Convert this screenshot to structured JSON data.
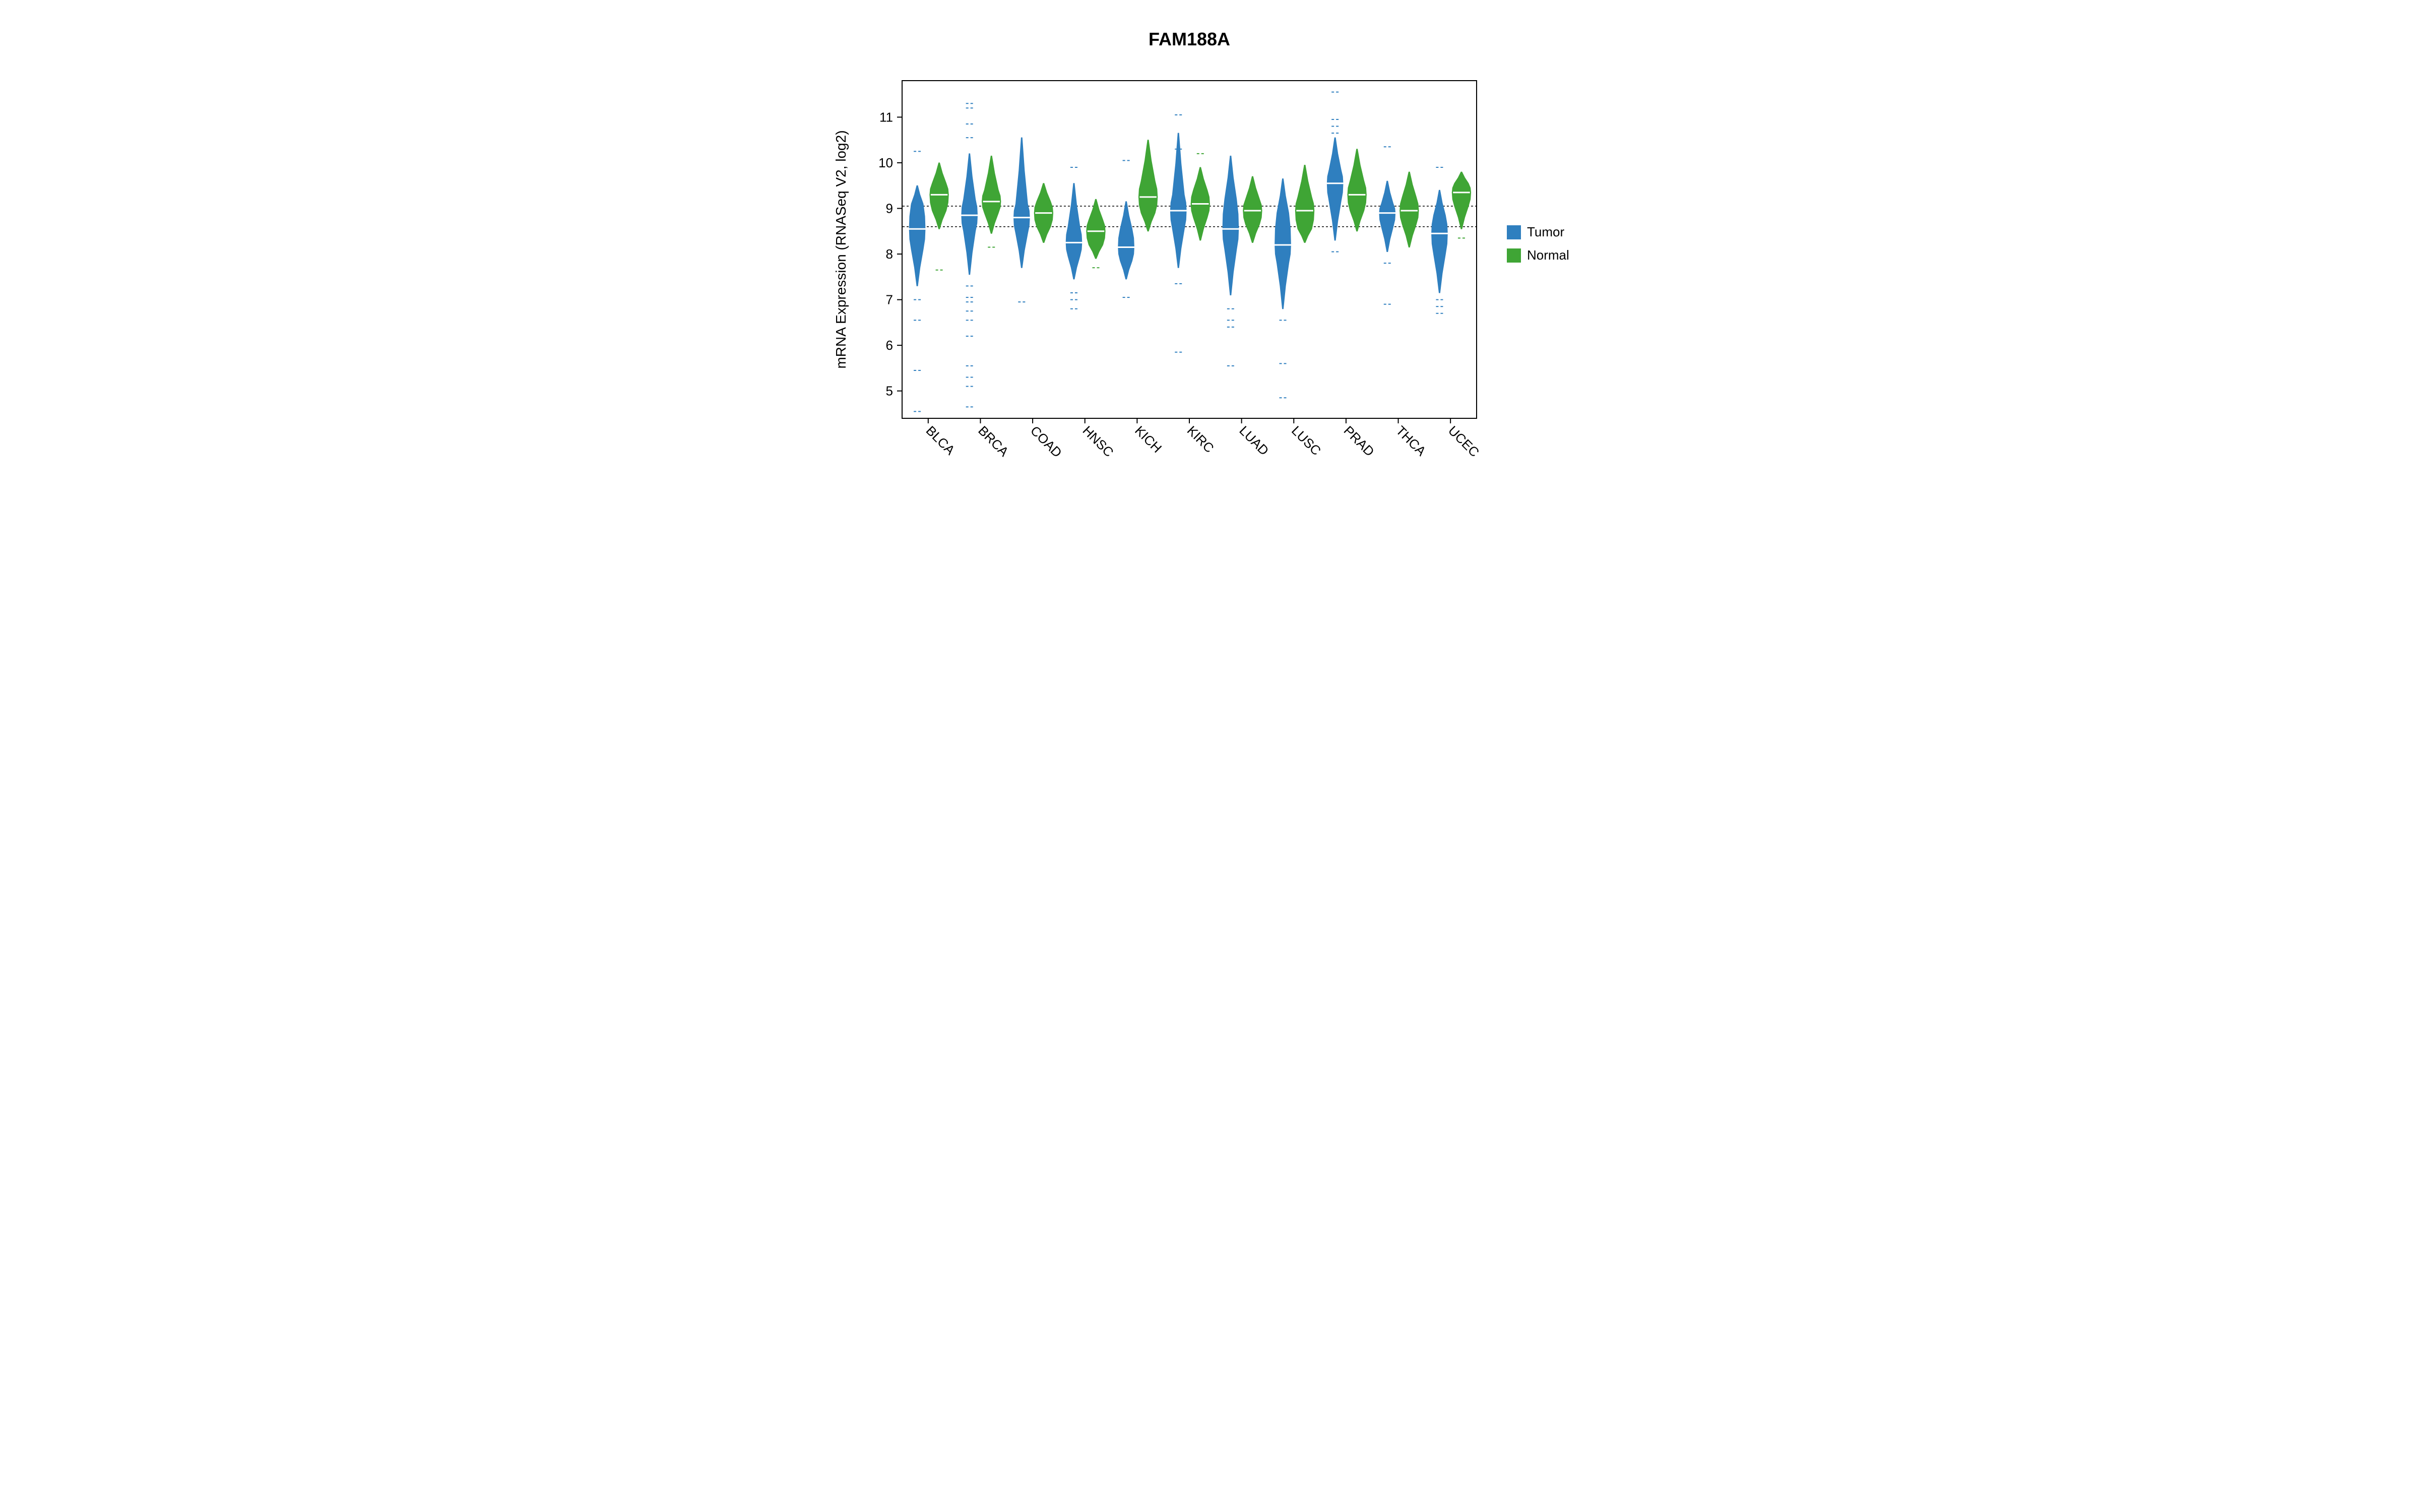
{
  "chart_data": {
    "type": "bar",
    "title": "FAM188A",
    "ylabel": "mRNA Expression (RNASeq V2, log2)",
    "xlabel": "",
    "ylim": [
      4.4,
      11.8
    ],
    "yticks": [
      5,
      6,
      7,
      8,
      9,
      10,
      11
    ],
    "categories": [
      "BLCA",
      "BRCA",
      "COAD",
      "HNSC",
      "KICH",
      "KIRC",
      "LUAD",
      "LUSC",
      "PRAD",
      "THCA",
      "UCEC"
    ],
    "reference_lines": [
      8.6,
      9.05
    ],
    "legend": {
      "items": [
        {
          "name": "Tumor",
          "color": "#2f7fbf"
        },
        {
          "name": "Normal",
          "color": "#3fa535"
        }
      ]
    },
    "series": [
      {
        "name": "Tumor",
        "color": "#2f7fbf",
        "distributions": [
          {
            "cat": "BLCA",
            "median": 8.55,
            "q1": 8.1,
            "q3": 9.1,
            "lo": 7.3,
            "hi": 9.5,
            "outliers": [
              10.25,
              7.0,
              6.55,
              5.45,
              4.55
            ]
          },
          {
            "cat": "BRCA",
            "median": 8.85,
            "q1": 8.5,
            "q3": 9.2,
            "lo": 7.55,
            "hi": 10.2,
            "outliers": [
              11.3,
              11.2,
              10.85,
              10.55,
              7.3,
              7.05,
              6.95,
              6.75,
              6.55,
              6.2,
              5.55,
              5.3,
              5.1,
              4.65
            ]
          },
          {
            "cat": "COAD",
            "median": 8.8,
            "q1": 8.45,
            "q3": 9.1,
            "lo": 7.7,
            "hi": 10.55,
            "outliers": [
              6.95
            ]
          },
          {
            "cat": "HNSC",
            "median": 8.25,
            "q1": 7.95,
            "q3": 8.6,
            "lo": 7.45,
            "hi": 9.55,
            "outliers": [
              9.9,
              7.15,
              7.0,
              6.8
            ]
          },
          {
            "cat": "KICH",
            "median": 8.15,
            "q1": 7.85,
            "q3": 8.55,
            "lo": 7.45,
            "hi": 9.15,
            "outliers": [
              10.05,
              7.05
            ]
          },
          {
            "cat": "KIRC",
            "median": 8.95,
            "q1": 8.55,
            "q3": 9.3,
            "lo": 7.7,
            "hi": 10.65,
            "outliers": [
              11.05,
              10.3,
              7.35,
              5.85
            ]
          },
          {
            "cat": "LUAD",
            "median": 8.55,
            "q1": 8.1,
            "q3": 9.2,
            "lo": 7.1,
            "hi": 10.15,
            "outliers": [
              6.8,
              6.55,
              6.4,
              5.55
            ]
          },
          {
            "cat": "LUSC",
            "median": 8.2,
            "q1": 7.8,
            "q3": 8.9,
            "lo": 6.8,
            "hi": 9.65,
            "outliers": [
              6.55,
              5.6,
              4.85
            ]
          },
          {
            "cat": "PRAD",
            "median": 9.55,
            "q1": 9.15,
            "q3": 9.85,
            "lo": 8.3,
            "hi": 10.55,
            "outliers": [
              11.55,
              10.95,
              10.8,
              10.65,
              8.05
            ]
          },
          {
            "cat": "THCA",
            "median": 8.9,
            "q1": 8.6,
            "q3": 9.1,
            "lo": 8.05,
            "hi": 9.6,
            "outliers": [
              10.35,
              7.8,
              6.9
            ]
          },
          {
            "cat": "UCEC",
            "median": 8.45,
            "q1": 8.0,
            "q3": 8.85,
            "lo": 7.15,
            "hi": 9.4,
            "outliers": [
              9.9,
              7.0,
              6.85,
              6.7
            ]
          }
        ]
      },
      {
        "name": "Normal",
        "color": "#3fa535",
        "distributions": [
          {
            "cat": "BLCA",
            "median": 9.3,
            "q1": 8.95,
            "q3": 9.55,
            "lo": 8.55,
            "hi": 10.0,
            "outliers": [
              7.65
            ]
          },
          {
            "cat": "BRCA",
            "median": 9.15,
            "q1": 8.9,
            "q3": 9.4,
            "lo": 8.45,
            "hi": 10.15,
            "outliers": [
              8.15
            ]
          },
          {
            "cat": "COAD",
            "median": 8.9,
            "q1": 8.6,
            "q3": 9.15,
            "lo": 8.25,
            "hi": 9.55,
            "outliers": []
          },
          {
            "cat": "HNSC",
            "median": 8.5,
            "q1": 8.2,
            "q3": 8.75,
            "lo": 7.9,
            "hi": 9.2,
            "outliers": [
              7.7
            ]
          },
          {
            "cat": "KICH",
            "median": 9.25,
            "q1": 8.9,
            "q3": 9.6,
            "lo": 8.5,
            "hi": 10.5,
            "outliers": []
          },
          {
            "cat": "KIRC",
            "median": 9.1,
            "q1": 8.8,
            "q3": 9.4,
            "lo": 8.3,
            "hi": 9.9,
            "outliers": [
              10.2
            ]
          },
          {
            "cat": "LUAD",
            "median": 8.95,
            "q1": 8.65,
            "q3": 9.2,
            "lo": 8.25,
            "hi": 9.7,
            "outliers": []
          },
          {
            "cat": "LUSC",
            "median": 8.95,
            "q1": 8.55,
            "q3": 9.25,
            "lo": 8.25,
            "hi": 9.95,
            "outliers": []
          },
          {
            "cat": "PRAD",
            "median": 9.3,
            "q1": 8.95,
            "q3": 9.6,
            "lo": 8.5,
            "hi": 10.3,
            "outliers": []
          },
          {
            "cat": "THCA",
            "median": 8.95,
            "q1": 8.65,
            "q3": 9.25,
            "lo": 8.15,
            "hi": 9.8,
            "outliers": []
          },
          {
            "cat": "UCEC",
            "median": 9.35,
            "q1": 9.05,
            "q3": 9.55,
            "lo": 8.55,
            "hi": 9.8,
            "outliers": [
              8.35
            ]
          }
        ]
      }
    ]
  }
}
